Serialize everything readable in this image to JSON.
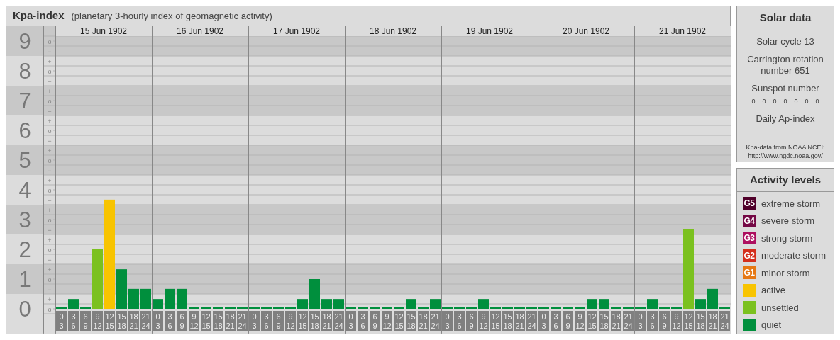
{
  "title": {
    "name": "Kpa-index",
    "subtitle": "(planetary 3-hourly index of geomagnetic activity)"
  },
  "chart": {
    "scale": [
      {
        "number": "9",
        "marks": [
          "o",
          "−"
        ]
      },
      {
        "number": "8",
        "marks": [
          "+",
          "o",
          "−"
        ]
      },
      {
        "number": "7",
        "marks": [
          "+",
          "o",
          "−"
        ]
      },
      {
        "number": "6",
        "marks": [
          "+",
          "o",
          "−"
        ]
      },
      {
        "number": "5",
        "marks": [
          "+",
          "o",
          "−"
        ]
      },
      {
        "number": "4",
        "marks": [
          "+",
          "o",
          "−"
        ]
      },
      {
        "number": "3",
        "marks": [
          "+",
          "o",
          "−"
        ]
      },
      {
        "number": "2",
        "marks": [
          "+",
          "o",
          "−"
        ]
      },
      {
        "number": "1",
        "marks": [
          "+",
          "o",
          "−"
        ]
      },
      {
        "number": "0",
        "marks": [
          "+",
          "o"
        ]
      }
    ],
    "days": [
      {
        "date": "15 Jun 1902",
        "intervals": [
          [
            "0",
            "3"
          ],
          [
            "3",
            "6"
          ],
          [
            "6",
            "9"
          ],
          [
            "9",
            "12"
          ],
          [
            "12",
            "15"
          ],
          [
            "15",
            "18"
          ],
          [
            "18",
            "21"
          ],
          [
            "21",
            "24"
          ]
        ]
      },
      {
        "date": "16 Jun 1902",
        "intervals": [
          [
            "0",
            "3"
          ],
          [
            "3",
            "6"
          ],
          [
            "6",
            "9"
          ],
          [
            "9",
            "12"
          ],
          [
            "12",
            "15"
          ],
          [
            "15",
            "18"
          ],
          [
            "18",
            "21"
          ],
          [
            "21",
            "24"
          ]
        ]
      },
      {
        "date": "17 Jun 1902",
        "intervals": [
          [
            "0",
            "3"
          ],
          [
            "3",
            "6"
          ],
          [
            "6",
            "9"
          ],
          [
            "9",
            "12"
          ],
          [
            "12",
            "15"
          ],
          [
            "15",
            "18"
          ],
          [
            "18",
            "21"
          ],
          [
            "21",
            "24"
          ]
        ]
      },
      {
        "date": "18 Jun 1902",
        "intervals": [
          [
            "0",
            "3"
          ],
          [
            "3",
            "6"
          ],
          [
            "6",
            "9"
          ],
          [
            "9",
            "12"
          ],
          [
            "12",
            "15"
          ],
          [
            "15",
            "18"
          ],
          [
            "18",
            "21"
          ],
          [
            "21",
            "24"
          ]
        ]
      },
      {
        "date": "19 Jun 1902",
        "intervals": [
          [
            "0",
            "3"
          ],
          [
            "3",
            "6"
          ],
          [
            "6",
            "9"
          ],
          [
            "9",
            "12"
          ],
          [
            "12",
            "15"
          ],
          [
            "15",
            "18"
          ],
          [
            "18",
            "21"
          ],
          [
            "21",
            "24"
          ]
        ]
      },
      {
        "date": "20 Jun 1902",
        "intervals": [
          [
            "0",
            "3"
          ],
          [
            "3",
            "6"
          ],
          [
            "6",
            "9"
          ],
          [
            "9",
            "12"
          ],
          [
            "12",
            "15"
          ],
          [
            "15",
            "18"
          ],
          [
            "18",
            "21"
          ],
          [
            "21",
            "24"
          ]
        ]
      },
      {
        "date": "21 Jun 1902",
        "intervals": [
          [
            "0",
            "3"
          ],
          [
            "3",
            "6"
          ],
          [
            "6",
            "9"
          ],
          [
            "9",
            "12"
          ],
          [
            "12",
            "15"
          ],
          [
            "15",
            "18"
          ],
          [
            "18",
            "21"
          ],
          [
            "21",
            "24"
          ]
        ]
      }
    ],
    "chart_data": {
      "type": "bar",
      "grid": true,
      "ylim": [
        -0.83,
        9.5
      ],
      "yticks": [
        0,
        1,
        2,
        3,
        4,
        5,
        6,
        7,
        8,
        9
      ],
      "bands": [
        {
          "axis": "y",
          "from": 8.5,
          "to": 9.5
        },
        {
          "axis": "y",
          "from": 6.5,
          "to": 7.5
        },
        {
          "axis": "y",
          "from": 4.5,
          "to": 5.5
        },
        {
          "axis": "y",
          "from": 2.5,
          "to": 3.5
        },
        {
          "axis": "y",
          "from": 0.5,
          "to": 1.5
        }
      ],
      "series": [
        {
          "color": "#008f3d",
          "values": [
            0,
            0.33,
            0,
            null,
            null,
            1.33,
            0.67,
            0.67,
            0.33,
            0.67,
            0.67,
            0,
            0,
            0,
            0,
            0,
            0,
            0,
            0,
            0,
            0.33,
            1,
            0.33,
            0.33,
            0,
            0,
            0,
            0,
            0,
            0.33,
            0,
            0.33,
            0,
            0,
            0,
            0.33,
            0,
            0,
            0,
            0,
            0,
            0,
            0,
            0,
            0.33,
            0.33,
            0,
            0,
            0,
            0.33,
            0,
            0,
            null,
            0.33,
            0.67,
            0
          ]
        },
        {
          "color": "#7bc11f",
          "values": [
            null,
            null,
            null,
            2,
            null,
            null,
            null,
            null,
            null,
            null,
            null,
            null,
            null,
            null,
            null,
            null,
            null,
            null,
            null,
            null,
            null,
            null,
            null,
            null,
            null,
            null,
            null,
            null,
            null,
            null,
            null,
            null,
            null,
            null,
            null,
            null,
            null,
            null,
            null,
            null,
            null,
            null,
            null,
            null,
            null,
            null,
            null,
            null,
            null,
            null,
            null,
            null,
            2.67,
            null,
            null,
            null
          ]
        },
        {
          "color": "#f8c400",
          "values": [
            null,
            null,
            null,
            null,
            3.67,
            null,
            null,
            null,
            null,
            null,
            null,
            null,
            null,
            null,
            null,
            null,
            null,
            null,
            null,
            null,
            null,
            null,
            null,
            null,
            null,
            null,
            null,
            null,
            null,
            null,
            null,
            null,
            null,
            null,
            null,
            null,
            null,
            null,
            null,
            null,
            null,
            null,
            null,
            null,
            null,
            null,
            null,
            null,
            null,
            null,
            null,
            null,
            null,
            null,
            null,
            null
          ]
        }
      ]
    }
  },
  "solar_data": {
    "heading": "Solar data",
    "cycle": "Solar cycle 13",
    "rotation": "Carrington rotation number 651",
    "sunspot_heading": "Sunspot number",
    "sunspot_numbers": [
      "0",
      "0",
      "0",
      "0",
      "0",
      "0",
      "0"
    ],
    "ap_heading": "Daily Ap-index",
    "ap_values": [
      "—",
      "—",
      "—",
      "—",
      "—",
      "—",
      "—"
    ],
    "source": "Kpa-data from NOAA NCEI:",
    "source_url": "http://www.ngdc.noaa.gov/"
  },
  "activity_levels": {
    "heading": "Activity levels",
    "items": [
      {
        "badge": "G5",
        "label": "extreme storm",
        "color": "#50002a"
      },
      {
        "badge": "G4",
        "label": "severe storm",
        "color": "#740845"
      },
      {
        "badge": "G3",
        "label": "strong storm",
        "color": "#ad0f5f"
      },
      {
        "badge": "G2",
        "label": "moderate storm",
        "color": "#d42f1d"
      },
      {
        "badge": "G1",
        "label": "minor storm",
        "color": "#e67814"
      },
      {
        "label": "active",
        "color": "#f8c400"
      },
      {
        "label": "unsettled",
        "color": "#7bc11f"
      },
      {
        "label": "quiet",
        "color": "#008f3d"
      }
    ]
  }
}
